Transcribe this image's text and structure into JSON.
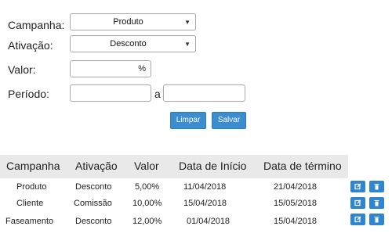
{
  "form": {
    "campanha_label": "Campanha:",
    "campanha_value": "Produto",
    "ativacao_label": "Ativação:",
    "ativacao_value": "Desconto",
    "valor_label": "Valor:",
    "valor_suffix": "%",
    "periodo_label": "Período:",
    "periodo_sep": "a"
  },
  "buttons": {
    "limpar": "Limpar",
    "salvar": "Salvar"
  },
  "table": {
    "headers": [
      "Campanha",
      "Ativação",
      "Valor",
      "Data de Início",
      "Data de término"
    ],
    "rows": [
      [
        "Produto",
        "Desconto",
        "5,00%",
        "11/04/2018",
        "21/04/2018"
      ],
      [
        "Cliente",
        "Comissão",
        "10,00%",
        "15/04/2018",
        "15/05/2018"
      ],
      [
        "Faseamento",
        "Desconto",
        "12,00%",
        "01/04/2018",
        "15/04/2018"
      ]
    ]
  },
  "icons": {
    "edit": "edit-icon",
    "delete": "trash-icon",
    "accent": "#2f86cf"
  }
}
